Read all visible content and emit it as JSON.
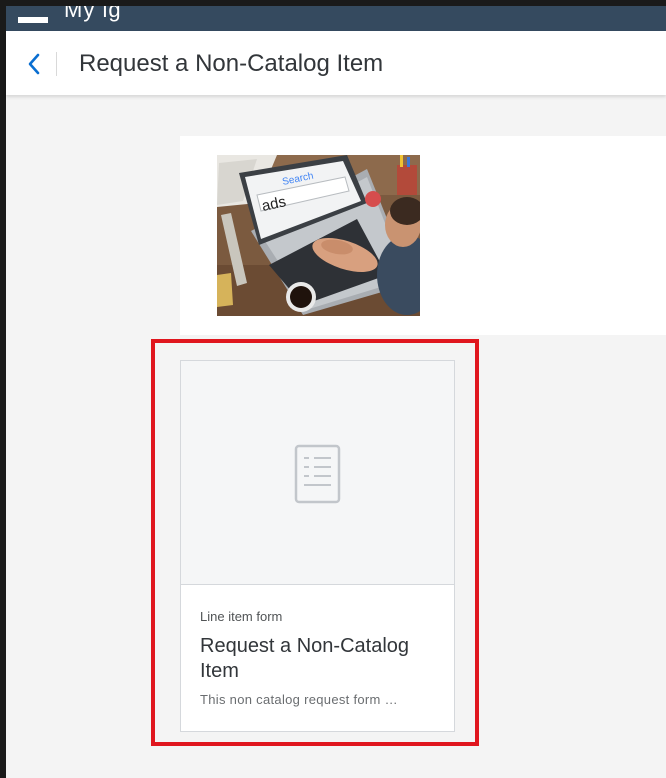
{
  "topbar": {
    "title_fragment": "My ig"
  },
  "header": {
    "title": "Request a Non-Catalog Item"
  },
  "banner": {
    "search_label": "Search",
    "search_text": "ads"
  },
  "card": {
    "type_label": "Line item form",
    "title": "Request a Non-Catalog Item",
    "description": "This non catalog request form …"
  },
  "colors": {
    "shell": "#354a5f",
    "accent": "#0a6ed1",
    "highlight": "#e0161e",
    "page_bg": "#f4f4f4"
  },
  "icons": [
    "back-chevron-icon",
    "document-icon"
  ]
}
